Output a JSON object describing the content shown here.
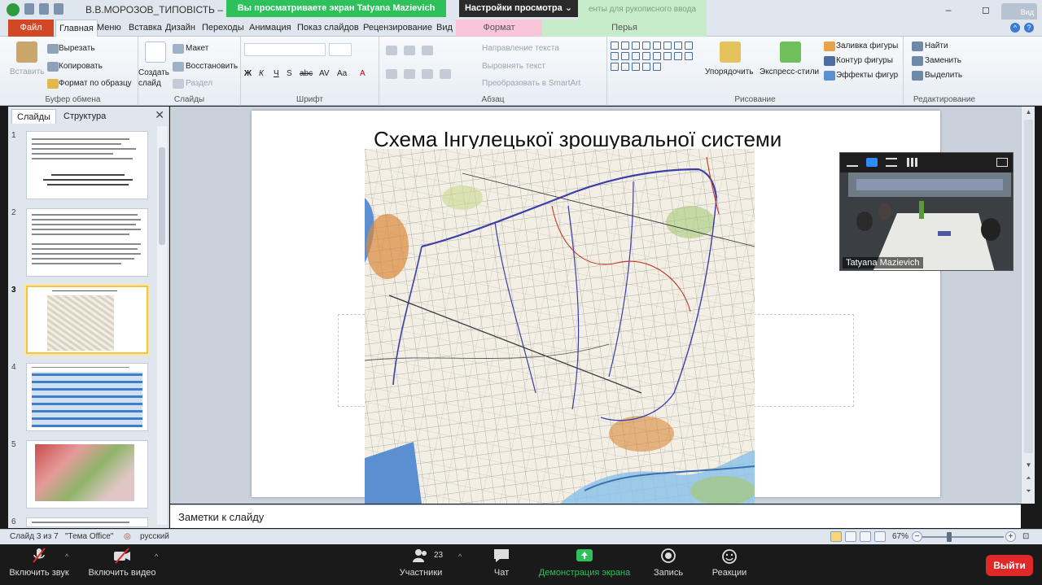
{
  "window": {
    "doc_title": "В.В.МОРОЗОВ_ТИПОВІСТЬ – ко",
    "share_banner": "Вы просматриваете экран Tatyana Mazievich",
    "view_options": "Настройки просмотра",
    "green_tools_label": "енты для рукописного ввода",
    "view_button": "Вид",
    "minimize": "–",
    "maximize": "◻",
    "close": "✕"
  },
  "ribbon_tabs": {
    "file": "Файл",
    "items": [
      "Главная",
      "Меню",
      "Вставка",
      "Дизайн",
      "Переходы",
      "Анимация",
      "Показ слайдов",
      "Рецензирование",
      "Вид"
    ],
    "ctx_format": "Формат",
    "ctx_pens": "Перья"
  },
  "ribbon": {
    "clipboard": {
      "paste": "Вставить",
      "cut": "Вырезать",
      "copy": "Копировать",
      "format_painter": "Формат по образцу",
      "label": "Буфер обмена"
    },
    "slides": {
      "create": "Создать слайд",
      "layout": "Макет",
      "reset": "Восстановить",
      "section": "Раздел",
      "label": "Слайды"
    },
    "font": {
      "label": "Шрифт",
      "buttons": [
        "Ж",
        "К",
        "Ч",
        "S",
        "abc",
        "AV",
        "Aa",
        "A"
      ]
    },
    "paragraph": {
      "direction": "Направление текста",
      "align": "Выровнять текст",
      "smartart": "Преобразовать в SmartArt",
      "label": "Абзац"
    },
    "drawing": {
      "arrange": "Упорядочить",
      "quick_styles": "Экспресс-стили",
      "fill": "Заливка фигуры",
      "outline": "Контур фигуры",
      "effects": "Эффекты фигур",
      "label": "Рисование"
    },
    "editing": {
      "find": "Найти",
      "replace": "Заменить",
      "select": "Выделить",
      "label": "Редактирование"
    }
  },
  "slides_panel": {
    "tab_slides": "Слайды",
    "tab_outline": "Структура",
    "close": "✕",
    "thumbnails": [
      "1",
      "2",
      "3",
      "4",
      "5",
      "6"
    ],
    "selected": 3
  },
  "slide": {
    "title": "Схема Інгулецької зрошувальної системи"
  },
  "video": {
    "participant_name": "Tatyana Mazievich"
  },
  "notes": {
    "placeholder": "Заметки к слайду"
  },
  "status": {
    "slide_info": "Слайд 3 из 7",
    "theme": "\"Тема Office\"",
    "language": "русский",
    "zoom": "67%",
    "zoom_fraction": 0.32
  },
  "meeting": {
    "mute": "Включить звук",
    "video": "Включить видео",
    "participants": "Участники",
    "participants_count": "23",
    "chat": "Чат",
    "share": "Демонстрация экрана",
    "record": "Запись",
    "reactions": "Реакции",
    "leave": "Выйти"
  },
  "colors": {
    "zoom_green": "#2dc05b",
    "file_tab": "#d24726",
    "leave_red": "#e02828",
    "canal_blue": "#3b3fa8"
  }
}
